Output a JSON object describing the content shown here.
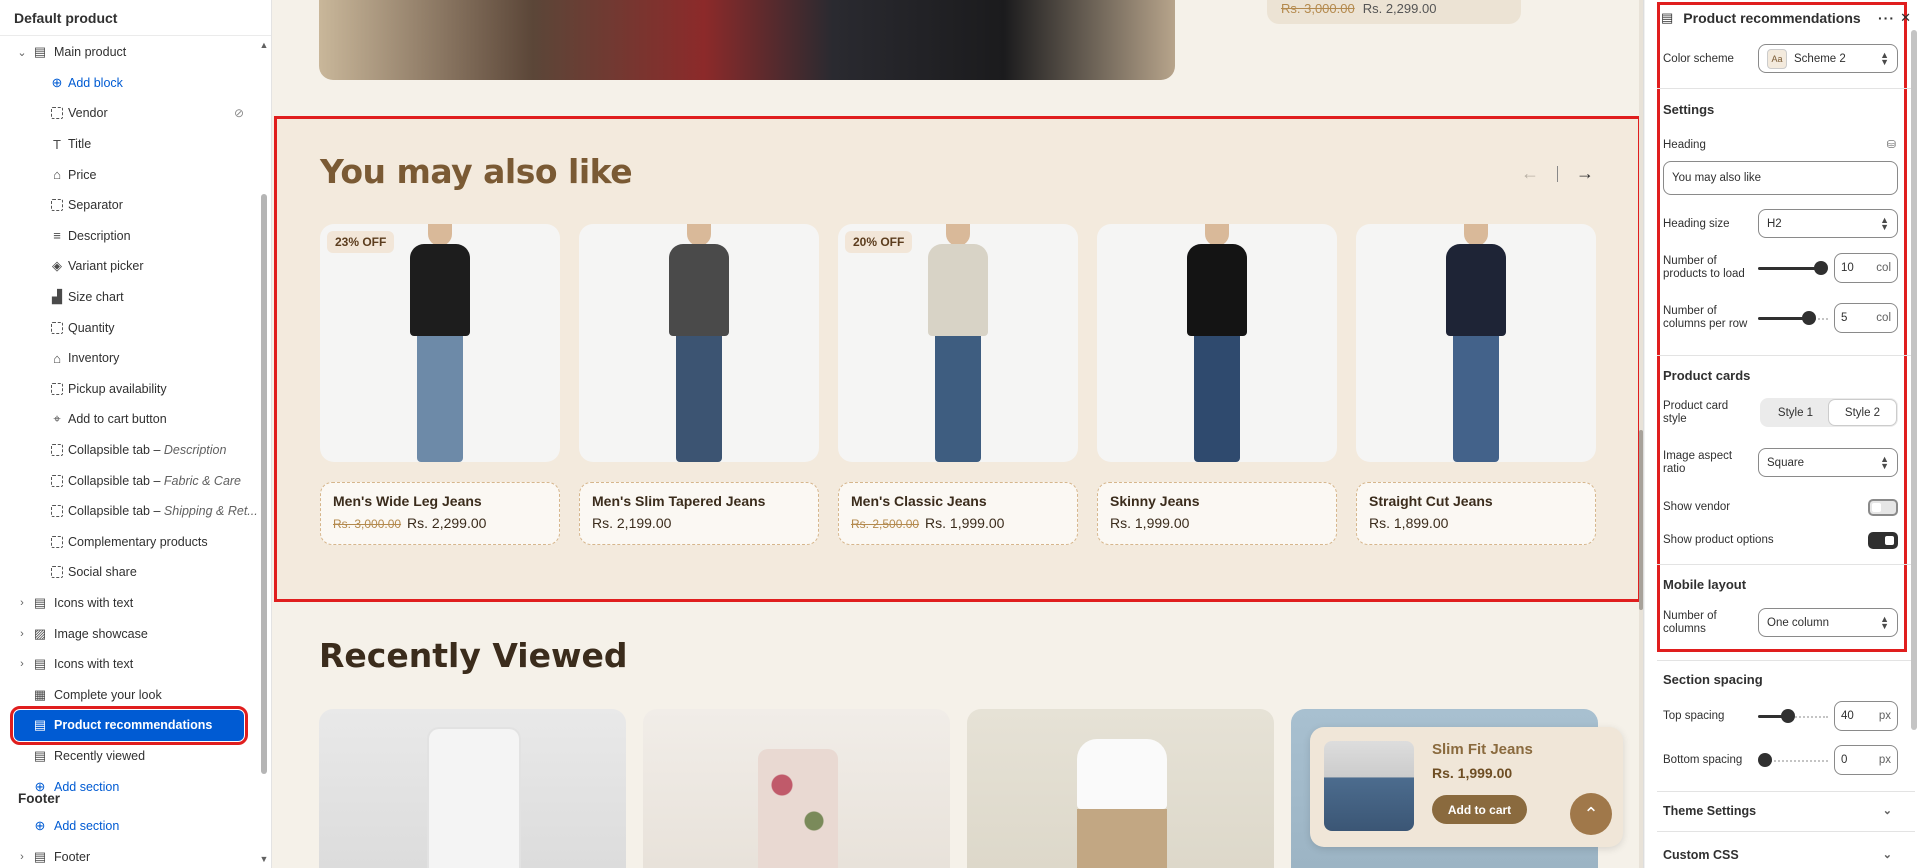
{
  "left_panel": {
    "title": "Default product",
    "tree": [
      {
        "label": "Main product",
        "icon": "section-icon",
        "level": 0,
        "chevron": "v"
      },
      {
        "label": "Add block",
        "icon": "plus-circle-icon",
        "level": 1,
        "add": true
      },
      {
        "label": "Vendor",
        "icon": "block-icon",
        "level": 1,
        "hidden": true
      },
      {
        "label": "Title",
        "icon": "text-icon",
        "level": 1
      },
      {
        "label": "Price",
        "icon": "price-tag-icon",
        "level": 1
      },
      {
        "label": "Separator",
        "icon": "block-icon",
        "level": 1
      },
      {
        "label": "Description",
        "icon": "paragraph-icon",
        "level": 1
      },
      {
        "label": "Variant picker",
        "icon": "variant-icon",
        "level": 1
      },
      {
        "label": "Size chart",
        "icon": "size-chart-icon",
        "level": 1
      },
      {
        "label": "Quantity",
        "icon": "block-icon",
        "level": 1
      },
      {
        "label": "Inventory",
        "icon": "inventory-icon",
        "level": 1
      },
      {
        "label": "Pickup availability",
        "icon": "block-icon",
        "level": 1
      },
      {
        "label": "Add to cart button",
        "icon": "cursor-icon",
        "level": 1
      },
      {
        "label": "Collapsible tab",
        "sub": "Description",
        "icon": "block-icon",
        "level": 1
      },
      {
        "label": "Collapsible tab",
        "sub": "Fabric & Care",
        "icon": "block-icon",
        "level": 1
      },
      {
        "label": "Collapsible tab",
        "sub": "Shipping & Ret...",
        "icon": "block-icon",
        "level": 1
      },
      {
        "label": "Complementary products",
        "icon": "block-icon",
        "level": 1
      },
      {
        "label": "Social share",
        "icon": "block-icon",
        "level": 1
      },
      {
        "label": "Icons with text",
        "icon": "section-icon",
        "level": 0,
        "chevron": ">"
      },
      {
        "label": "Image showcase",
        "icon": "image-icon",
        "level": 0,
        "chevron": ">"
      },
      {
        "label": "Icons with text",
        "icon": "section-icon",
        "level": 0,
        "chevron": ">"
      },
      {
        "label": "Complete your look",
        "icon": "grid-icon",
        "level": 0
      },
      {
        "label": "Product recommendations",
        "icon": "section-icon",
        "level": 0,
        "selected": true
      },
      {
        "label": "Recently viewed",
        "icon": "section-icon",
        "level": 0
      },
      {
        "label": "Add section",
        "icon": "plus-circle-icon",
        "level": 0,
        "add": true
      }
    ],
    "footer_heading": "Footer",
    "footer_tree": [
      {
        "label": "Add section",
        "icon": "plus-circle-icon",
        "level": 0,
        "add": true
      },
      {
        "label": "Footer",
        "icon": "section-icon",
        "level": 0,
        "chevron": ">"
      }
    ]
  },
  "preview": {
    "hero_old_price": "Rs. 3,000.00",
    "hero_price": "Rs. 2,299.00",
    "recs_heading": "You may also like",
    "products": [
      {
        "name": "Men's Wide Leg Jeans",
        "old_price": "Rs. 3,000.00",
        "price": "Rs. 2,299.00",
        "badge": "23% OFF",
        "top": "#1d1d1d",
        "legs": "#6d8aa8"
      },
      {
        "name": "Men's Slim Tapered Jeans",
        "old_price": "",
        "price": "Rs. 2,199.00",
        "badge": "",
        "top": "#4a4a4a",
        "legs": "#3c5472"
      },
      {
        "name": "Men's Classic Jeans",
        "old_price": "Rs. 2,500.00",
        "price": "Rs. 1,999.00",
        "badge": "20% OFF",
        "top": "#d8d3c6",
        "legs": "#3e5d80"
      },
      {
        "name": "Skinny Jeans",
        "old_price": "",
        "price": "Rs. 1,999.00",
        "badge": "",
        "top": "#141414",
        "legs": "#2f4a6e"
      },
      {
        "name": "Straight Cut Jeans",
        "old_price": "",
        "price": "Rs. 1,899.00",
        "badge": "",
        "top": "#1e2436",
        "legs": "#43628a"
      }
    ],
    "recent_heading": "Recently Viewed",
    "popup": {
      "name": "Slim Fit Jeans",
      "price": "Rs. 1,999.00",
      "button": "Add to cart"
    }
  },
  "right_panel": {
    "title": "Product recommendations",
    "color_scheme_label": "Color scheme",
    "color_scheme_value": "Scheme 2",
    "settings_heading": "Settings",
    "heading_label": "Heading",
    "heading_value": "You may also like",
    "heading_size_label": "Heading size",
    "heading_size_value": "H2",
    "products_to_load_label": "Number of products to load",
    "products_to_load_value": "10",
    "columns_per_row_label": "Number of columns per row",
    "columns_per_row_value": "5",
    "col_unit": "col",
    "product_cards_heading": "Product cards",
    "card_style_label": "Product card style",
    "card_style_options": [
      "Style 1",
      "Style 2"
    ],
    "card_style_selected": "Style 2",
    "aspect_label": "Image aspect ratio",
    "aspect_value": "Square",
    "show_vendor_label": "Show vendor",
    "show_vendor": false,
    "show_options_label": "Show product options",
    "show_options": true,
    "mobile_heading": "Mobile layout",
    "mobile_columns_label": "Number of columns",
    "mobile_columns_value": "One column",
    "spacing_heading": "Section spacing",
    "top_spacing_label": "Top spacing",
    "top_spacing_value": "40",
    "bottom_spacing_label": "Bottom spacing",
    "bottom_spacing_value": "0",
    "px_unit": "px",
    "theme_settings": "Theme Settings",
    "custom_css": "Custom CSS"
  },
  "colors": {
    "accent_blue": "#005bd3",
    "highlight_red": "#e01e1e",
    "brand_brown": "#7a5a34"
  }
}
